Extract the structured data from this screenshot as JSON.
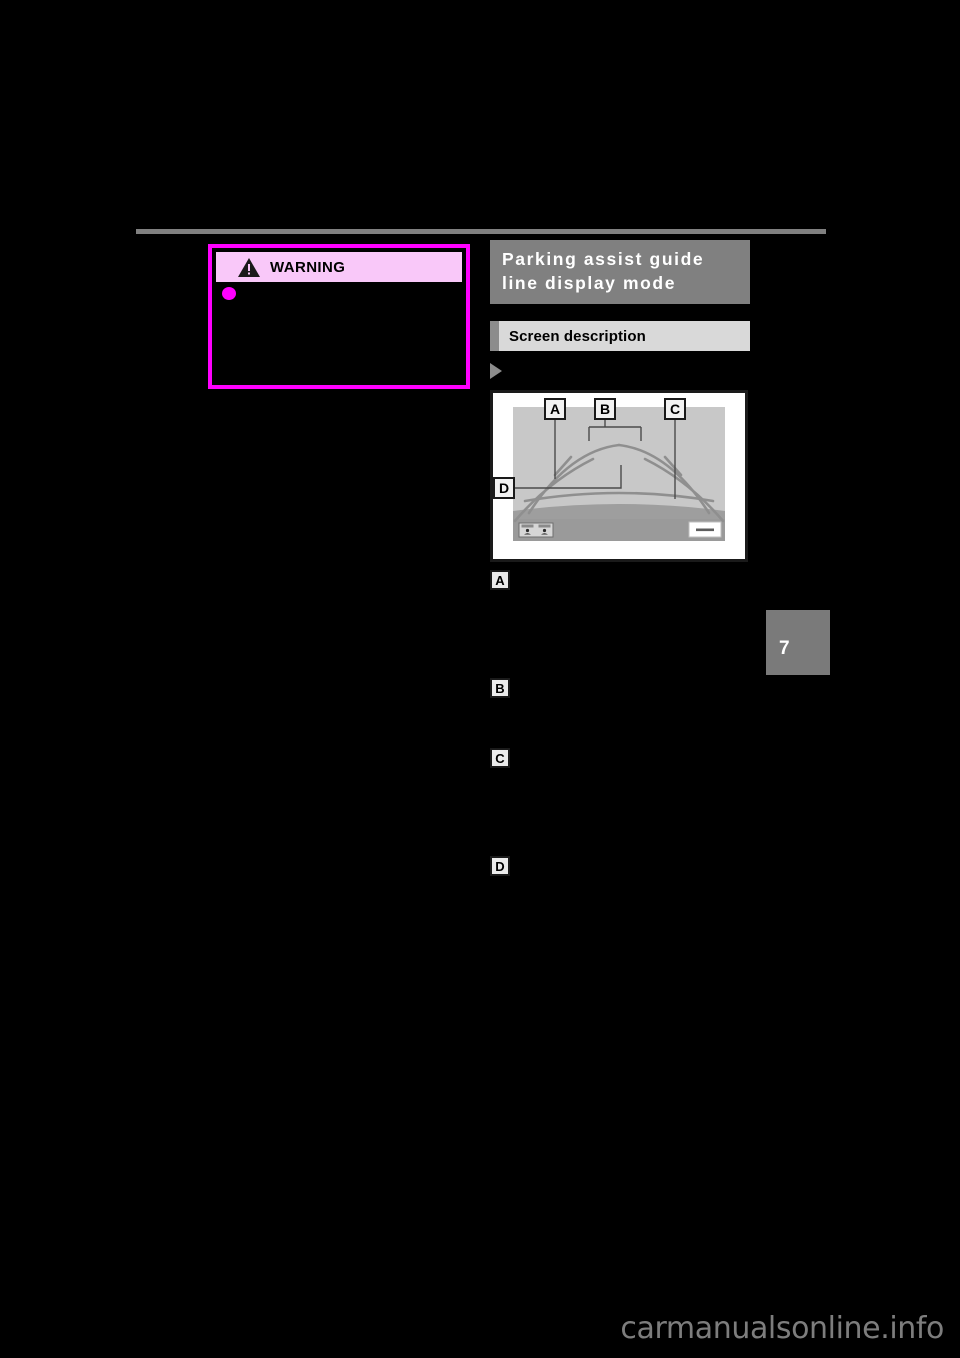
{
  "page": {
    "background_color": "#000000",
    "chapter_number": "7",
    "watermark": "carmanualsonline.info"
  },
  "warning_panel": {
    "icon": "warning-triangle-icon",
    "title": "WARNING",
    "border_color": "#ff00ff",
    "header_color": "#f9c8f9",
    "bullet_color": "#ff00ff",
    "body_text": ""
  },
  "right_column": {
    "section_title": "Parking assist guide line display mode",
    "section_title_color": "#808080",
    "subsection": {
      "label": "Screen description",
      "tab_color": "#8c8c8c",
      "background_color": "#d9d9d9"
    },
    "arrow_marker": {
      "icon": "play-triangle-icon",
      "label": ""
    }
  },
  "figure": {
    "name": "rear-view-camera-guide-lines",
    "frame_color": "#1a1a1a",
    "sky_color": "#c8c8c8",
    "ground_color": "#9a9a9a",
    "guide_line_color": "#8a8a8a",
    "callout_markers": [
      "A",
      "B",
      "C",
      "D"
    ],
    "view_switch_icon": "camera-view-toggle-icon",
    "bottom_right_button_icon": "dash-button-icon"
  },
  "callouts": [
    {
      "id": "A",
      "text": ""
    },
    {
      "id": "B",
      "text": ""
    },
    {
      "id": "C",
      "text": ""
    },
    {
      "id": "D",
      "text": ""
    }
  ]
}
